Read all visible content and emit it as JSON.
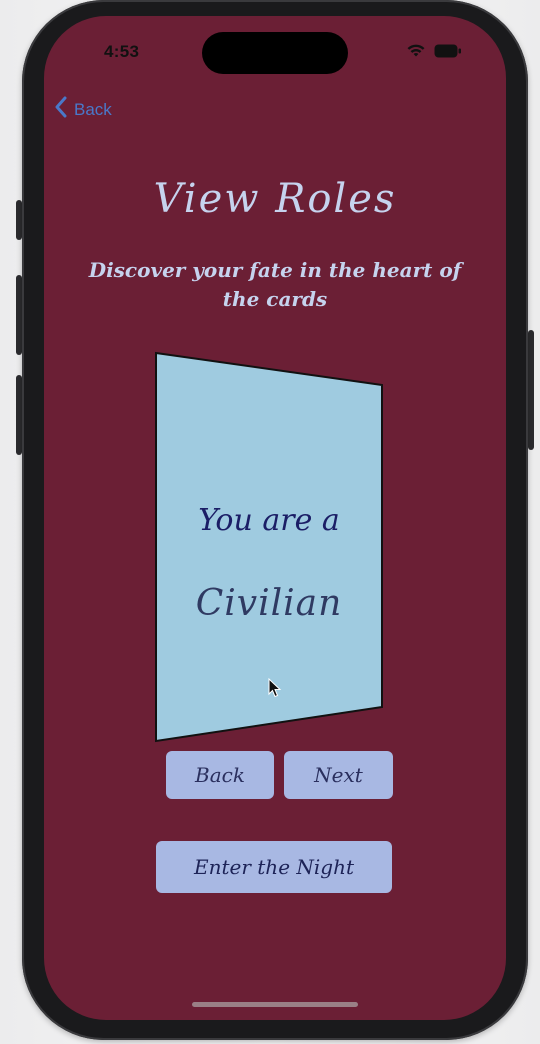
{
  "status_bar": {
    "time": "4:53",
    "icons": [
      "wifi-icon",
      "battery-icon"
    ]
  },
  "nav": {
    "back_label": "Back",
    "back_icon": "chevron-left-icon"
  },
  "header": {
    "title": "View Roles",
    "subtitle": "Discover your fate in the heart of the cards"
  },
  "card": {
    "line1": "You are a",
    "role": "Civilian"
  },
  "controls": {
    "back_label": "Back",
    "next_label": "Next",
    "enter_label": "Enter the Night"
  },
  "colors": {
    "background": "#6b1f35",
    "card": "#9fcbe0",
    "button": "#a8b8e3",
    "title_text": "#c6d3ee",
    "link": "#4a78c9"
  }
}
